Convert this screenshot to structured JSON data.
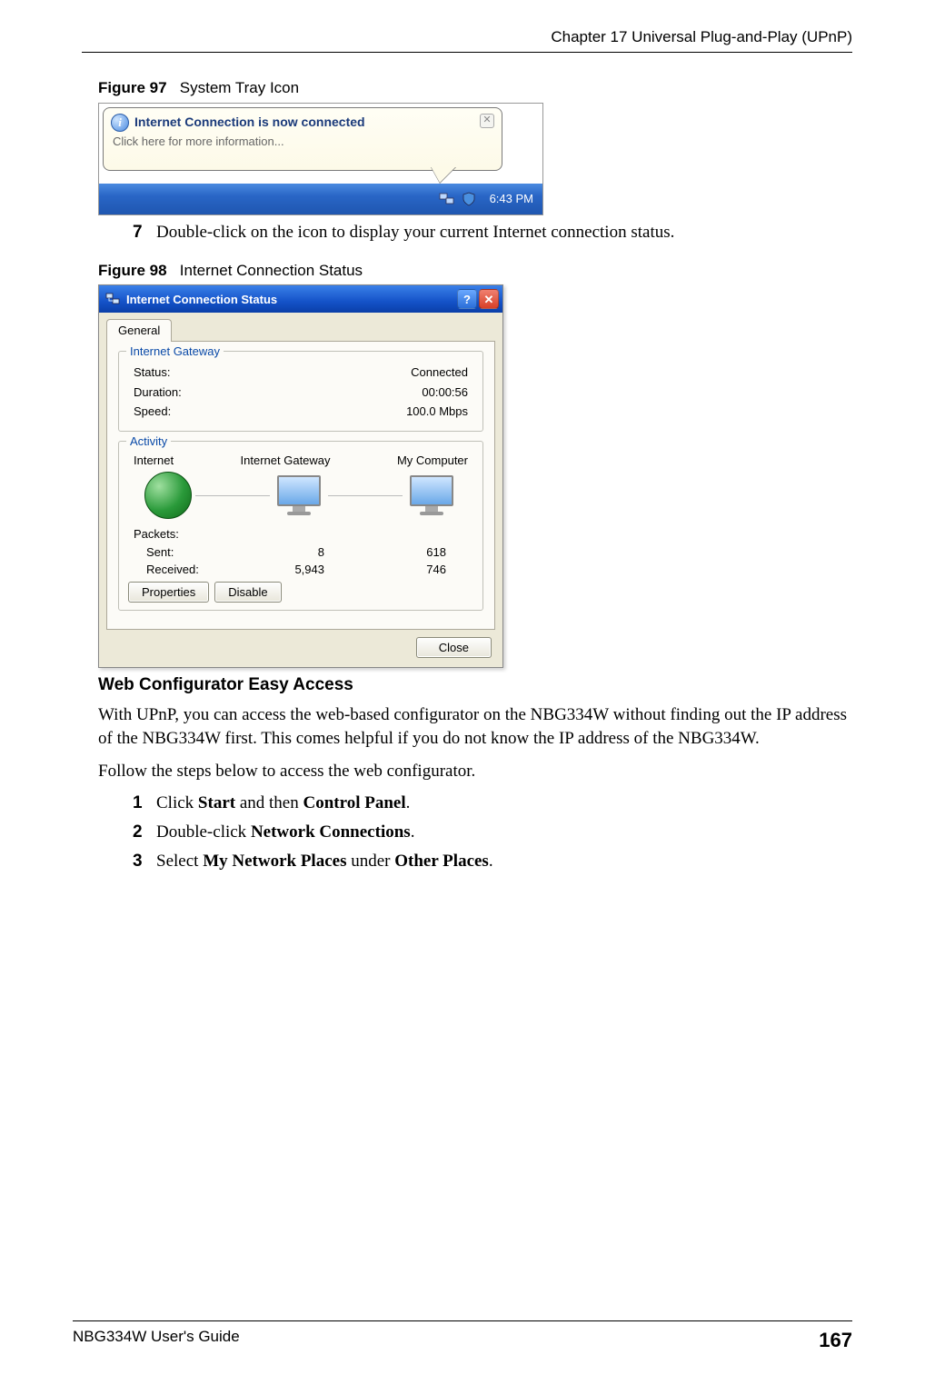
{
  "header": {
    "chapter": "Chapter 17 Universal Plug-and-Play (UPnP)"
  },
  "figure97": {
    "caption_label": "Figure 97",
    "caption_text": "System Tray Icon",
    "balloon_title": "Internet Connection is now connected",
    "balloon_sub": "Click here for more information...",
    "clock": "6:43 PM"
  },
  "step7": {
    "num": "7",
    "text": "Double-click on the icon to display your current Internet connection status."
  },
  "figure98": {
    "caption_label": "Figure 98",
    "caption_text": "Internet Connection Status",
    "title": "Internet Connection Status",
    "tab": "General",
    "group_gateway": {
      "legend": "Internet Gateway",
      "status_k": "Status:",
      "status_v": "Connected",
      "duration_k": "Duration:",
      "duration_v": "00:00:56",
      "speed_k": "Speed:",
      "speed_v": "100.0 Mbps"
    },
    "group_activity": {
      "legend": "Activity",
      "col_internet": "Internet",
      "col_gateway": "Internet Gateway",
      "col_mycomputer": "My Computer",
      "packets_label": "Packets:",
      "sent_label": "Sent:",
      "received_label": "Received:",
      "sent_gw": "8",
      "sent_pc": "618",
      "recv_gw": "5,943",
      "recv_pc": "746",
      "btn_properties": "Properties",
      "btn_disable": "Disable"
    },
    "btn_close": "Close"
  },
  "section": {
    "heading": "Web Configurator Easy Access",
    "para1": "With UPnP, you can access the web-based configurator on the NBG334W without finding out the IP address of the NBG334W first. This comes helpful if you do not know the IP address of the NBG334W.",
    "para2": "Follow the steps below to access the web configurator.",
    "steps": [
      {
        "num": "1",
        "pre": "Click ",
        "b1": "Start",
        "mid": " and then ",
        "b2": "Control Panel",
        "post": "."
      },
      {
        "num": "2",
        "pre": "Double-click ",
        "b1": "Network Connections",
        "mid": "",
        "b2": "",
        "post": "."
      },
      {
        "num": "3",
        "pre": "Select ",
        "b1": "My Network Places",
        "mid": " under ",
        "b2": "Other Places",
        "post": "."
      }
    ]
  },
  "footer": {
    "guide": "NBG334W User's Guide",
    "page": "167"
  }
}
